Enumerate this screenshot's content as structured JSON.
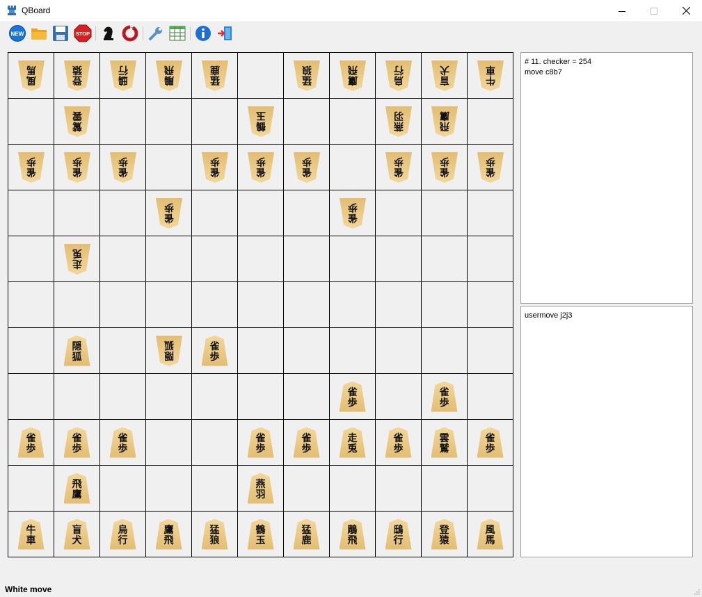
{
  "window": {
    "title": "QBoard",
    "controls": [
      "minimize",
      "maximize",
      "close"
    ]
  },
  "toolbar": {
    "new_label": "NEW",
    "stop_label": "STOP",
    "icons": [
      "new-icon",
      "open-folder-icon",
      "save-icon",
      "stop-icon",
      "knight-icon",
      "lifebuoy-icon",
      "wrench-icon",
      "table-icon",
      "info-icon",
      "exit-icon"
    ]
  },
  "board": {
    "size": 11,
    "rows": [
      [
        {
          "s": "b",
          "t": [
            "風",
            "馬"
          ]
        },
        {
          "s": "b",
          "t": [
            "登",
            "猿"
          ]
        },
        {
          "s": "b",
          "t": [
            "鴟",
            "行"
          ]
        },
        {
          "s": "b",
          "t": [
            "鵰",
            "飛"
          ]
        },
        {
          "s": "b",
          "t": [
            "猛",
            "鹿"
          ]
        },
        null,
        {
          "s": "b",
          "t": [
            "猛",
            "狼"
          ]
        },
        {
          "s": "b",
          "t": [
            "鷹",
            "飛"
          ]
        },
        {
          "s": "b",
          "t": [
            "烏",
            "行"
          ]
        },
        {
          "s": "b",
          "t": [
            "盲",
            "犬"
          ]
        },
        {
          "s": "b",
          "t": [
            "牛",
            "車"
          ]
        }
      ],
      [
        null,
        {
          "s": "b",
          "t": [
            "鷲",
            "雲"
          ]
        },
        null,
        null,
        null,
        {
          "s": "b",
          "t": [
            "鶴",
            "玉"
          ]
        },
        null,
        null,
        {
          "s": "b",
          "t": [
            "燕",
            "羽"
          ]
        },
        {
          "s": "b",
          "t": [
            "飛",
            "鷹"
          ]
        },
        null
      ],
      [
        {
          "s": "b",
          "t": [
            "雀",
            "歩"
          ]
        },
        {
          "s": "b",
          "t": [
            "雀",
            "歩"
          ]
        },
        {
          "s": "b",
          "t": [
            "雀",
            "歩"
          ]
        },
        null,
        {
          "s": "b",
          "t": [
            "雀",
            "歩"
          ]
        },
        {
          "s": "b",
          "t": [
            "雀",
            "歩"
          ]
        },
        {
          "s": "b",
          "t": [
            "雀",
            "歩"
          ]
        },
        null,
        {
          "s": "b",
          "t": [
            "雀",
            "歩"
          ]
        },
        {
          "s": "b",
          "t": [
            "雀",
            "歩"
          ]
        },
        {
          "s": "b",
          "t": [
            "雀",
            "歩"
          ]
        }
      ],
      [
        null,
        null,
        null,
        {
          "s": "b",
          "t": [
            "雀",
            "歩"
          ]
        },
        null,
        null,
        null,
        {
          "s": "b",
          "t": [
            "雀",
            "歩"
          ]
        },
        null,
        null,
        null
      ],
      [
        null,
        {
          "s": "b",
          "t": [
            "走",
            "兎"
          ]
        },
        null,
        null,
        null,
        null,
        null,
        null,
        null,
        null,
        null
      ],
      [
        null,
        null,
        null,
        null,
        null,
        null,
        null,
        null,
        null,
        null,
        null
      ],
      [
        null,
        {
          "s": "w",
          "t": [
            "隠",
            "狐"
          ]
        },
        null,
        {
          "s": "b",
          "t": [
            "隠",
            "狐"
          ]
        },
        {
          "s": "w",
          "t": [
            "雀",
            "歩"
          ]
        },
        null,
        null,
        null,
        null,
        null,
        null
      ],
      [
        null,
        null,
        null,
        null,
        null,
        null,
        null,
        {
          "s": "w",
          "t": [
            "雀",
            "歩"
          ]
        },
        null,
        {
          "s": "w",
          "t": [
            "雀",
            "歩"
          ]
        },
        null
      ],
      [
        {
          "s": "w",
          "t": [
            "雀",
            "歩"
          ]
        },
        {
          "s": "w",
          "t": [
            "雀",
            "歩"
          ]
        },
        {
          "s": "w",
          "t": [
            "雀",
            "歩"
          ]
        },
        null,
        null,
        {
          "s": "w",
          "t": [
            "雀",
            "歩"
          ]
        },
        {
          "s": "w",
          "t": [
            "雀",
            "歩"
          ]
        },
        {
          "s": "w",
          "t": [
            "走",
            "兎"
          ]
        },
        {
          "s": "w",
          "t": [
            "雀",
            "歩"
          ]
        },
        {
          "s": "w",
          "t": [
            "雲",
            "鷲"
          ]
        },
        {
          "s": "w",
          "t": [
            "雀",
            "歩"
          ]
        }
      ],
      [
        null,
        {
          "s": "w",
          "t": [
            "飛",
            "鷹"
          ]
        },
        null,
        null,
        null,
        {
          "s": "w",
          "t": [
            "燕",
            "羽"
          ]
        },
        null,
        null,
        null,
        null,
        null
      ],
      [
        {
          "s": "w",
          "t": [
            "牛",
            "車"
          ]
        },
        {
          "s": "w",
          "t": [
            "盲",
            "犬"
          ]
        },
        {
          "s": "w",
          "t": [
            "烏",
            "行"
          ]
        },
        {
          "s": "w",
          "t": [
            "鷹",
            "飛"
          ]
        },
        {
          "s": "w",
          "t": [
            "猛",
            "狼"
          ]
        },
        {
          "s": "w",
          "t": [
            "鶴",
            "玉"
          ]
        },
        {
          "s": "w",
          "t": [
            "猛",
            "鹿"
          ]
        },
        {
          "s": "w",
          "t": [
            "鵰",
            "飛"
          ]
        },
        {
          "s": "w",
          "t": [
            "鴟",
            "行"
          ]
        },
        {
          "s": "w",
          "t": [
            "登",
            "猿"
          ]
        },
        {
          "s": "w",
          "t": [
            "風",
            "馬"
          ]
        }
      ]
    ]
  },
  "engine_output": {
    "lines": [
      "# 11. checker = 254",
      "move c8b7"
    ]
  },
  "user_log": {
    "lines": [
      "usermove j2j3"
    ]
  },
  "status": {
    "text": "White move"
  },
  "colors": {
    "piece_light": "#f2d79a",
    "piece_dark": "#e3bd72",
    "stop_red": "#d92020",
    "new_blue": "#1a74d6",
    "info_blue": "#1f6fd1"
  }
}
